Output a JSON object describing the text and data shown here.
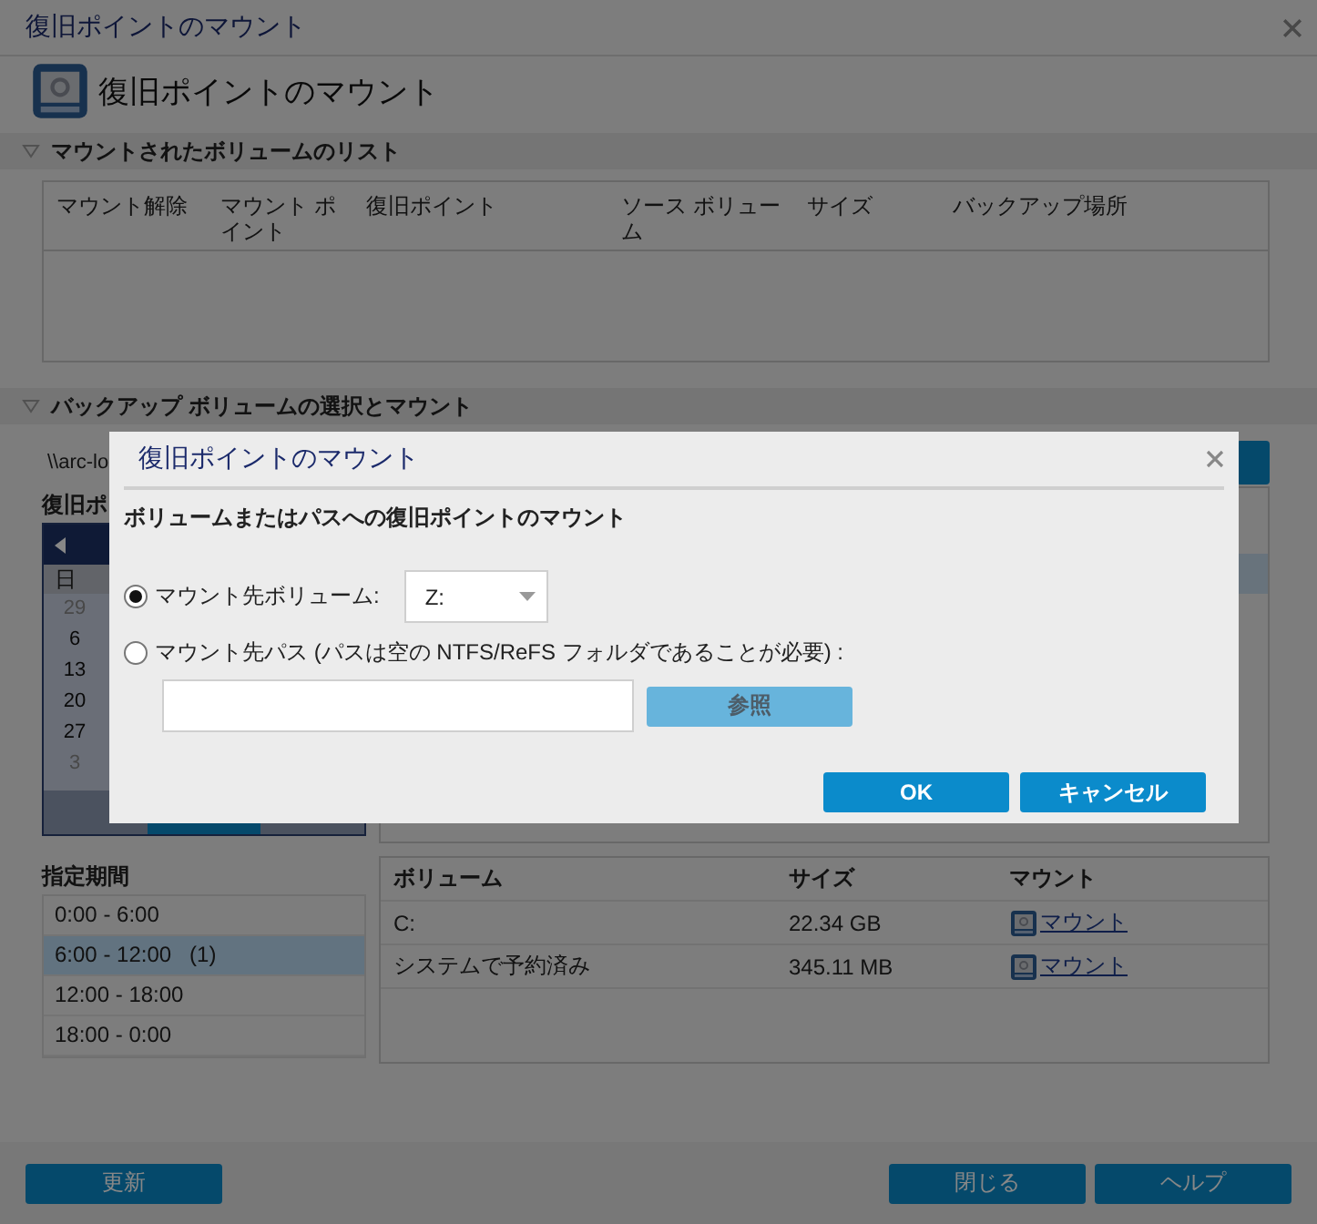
{
  "window": {
    "title": "復旧ポイントのマウント"
  },
  "header": {
    "title": "復旧ポイントのマウント"
  },
  "mounted_volumes": {
    "title": "マウントされたボリュームのリスト",
    "expanded": true,
    "columns": [
      "マウント解除",
      "マウント ポイント",
      "復旧ポイント",
      "ソース ボリューム",
      "サイズ",
      "バックアップ場所"
    ]
  },
  "backup_selection": {
    "title": "バックアップ ボリュームの選択とマウント",
    "expanded": true,
    "path": "\\\\arc-lo",
    "recovery_point_label": "復旧ポ",
    "calendar": {
      "weekday": "日",
      "days": [
        {
          "label": "29",
          "outside": true
        },
        {
          "label": "6",
          "outside": false
        },
        {
          "label": "13",
          "outside": false
        },
        {
          "label": "20",
          "outside": false
        },
        {
          "label": "27",
          "outside": false
        },
        {
          "label": "3",
          "outside": true
        }
      ]
    },
    "time_ranges": {
      "title": "指定期間",
      "items": [
        {
          "label": "0:00 - 6:00",
          "selected": false
        },
        {
          "label": "6:00 - 12:00   (1)",
          "selected": true
        },
        {
          "label": "12:00 - 18:00",
          "selected": false
        },
        {
          "label": "18:00 - 0:00",
          "selected": false
        }
      ]
    },
    "volumes": {
      "columns": [
        "ボリューム",
        "サイズ",
        "マウント"
      ],
      "rows": [
        {
          "volume": "C:",
          "size": "22.34 GB",
          "action": "マウント"
        },
        {
          "volume": "システムで予約済み",
          "size": "345.11 MB",
          "action": "マウント"
        }
      ]
    }
  },
  "footer": {
    "left_buttons": [
      "更新"
    ],
    "right_buttons": [
      "閉じる",
      "ヘルプ"
    ]
  },
  "dialog": {
    "title": "復旧ポイントのマウント",
    "heading": "ボリュームまたはパスへの復旧ポイントのマウント",
    "options": [
      {
        "kind": "volume",
        "label": "マウント先ボリューム:",
        "selected": true,
        "value": "Z:"
      },
      {
        "kind": "path",
        "label": "マウント先パス (パスは空の NTFS/ReFS フォルダであることが必要) :",
        "selected": false,
        "browse": "参照",
        "browse_disabled": true
      }
    ],
    "buttons": [
      "OK",
      "キャンセル"
    ]
  }
}
